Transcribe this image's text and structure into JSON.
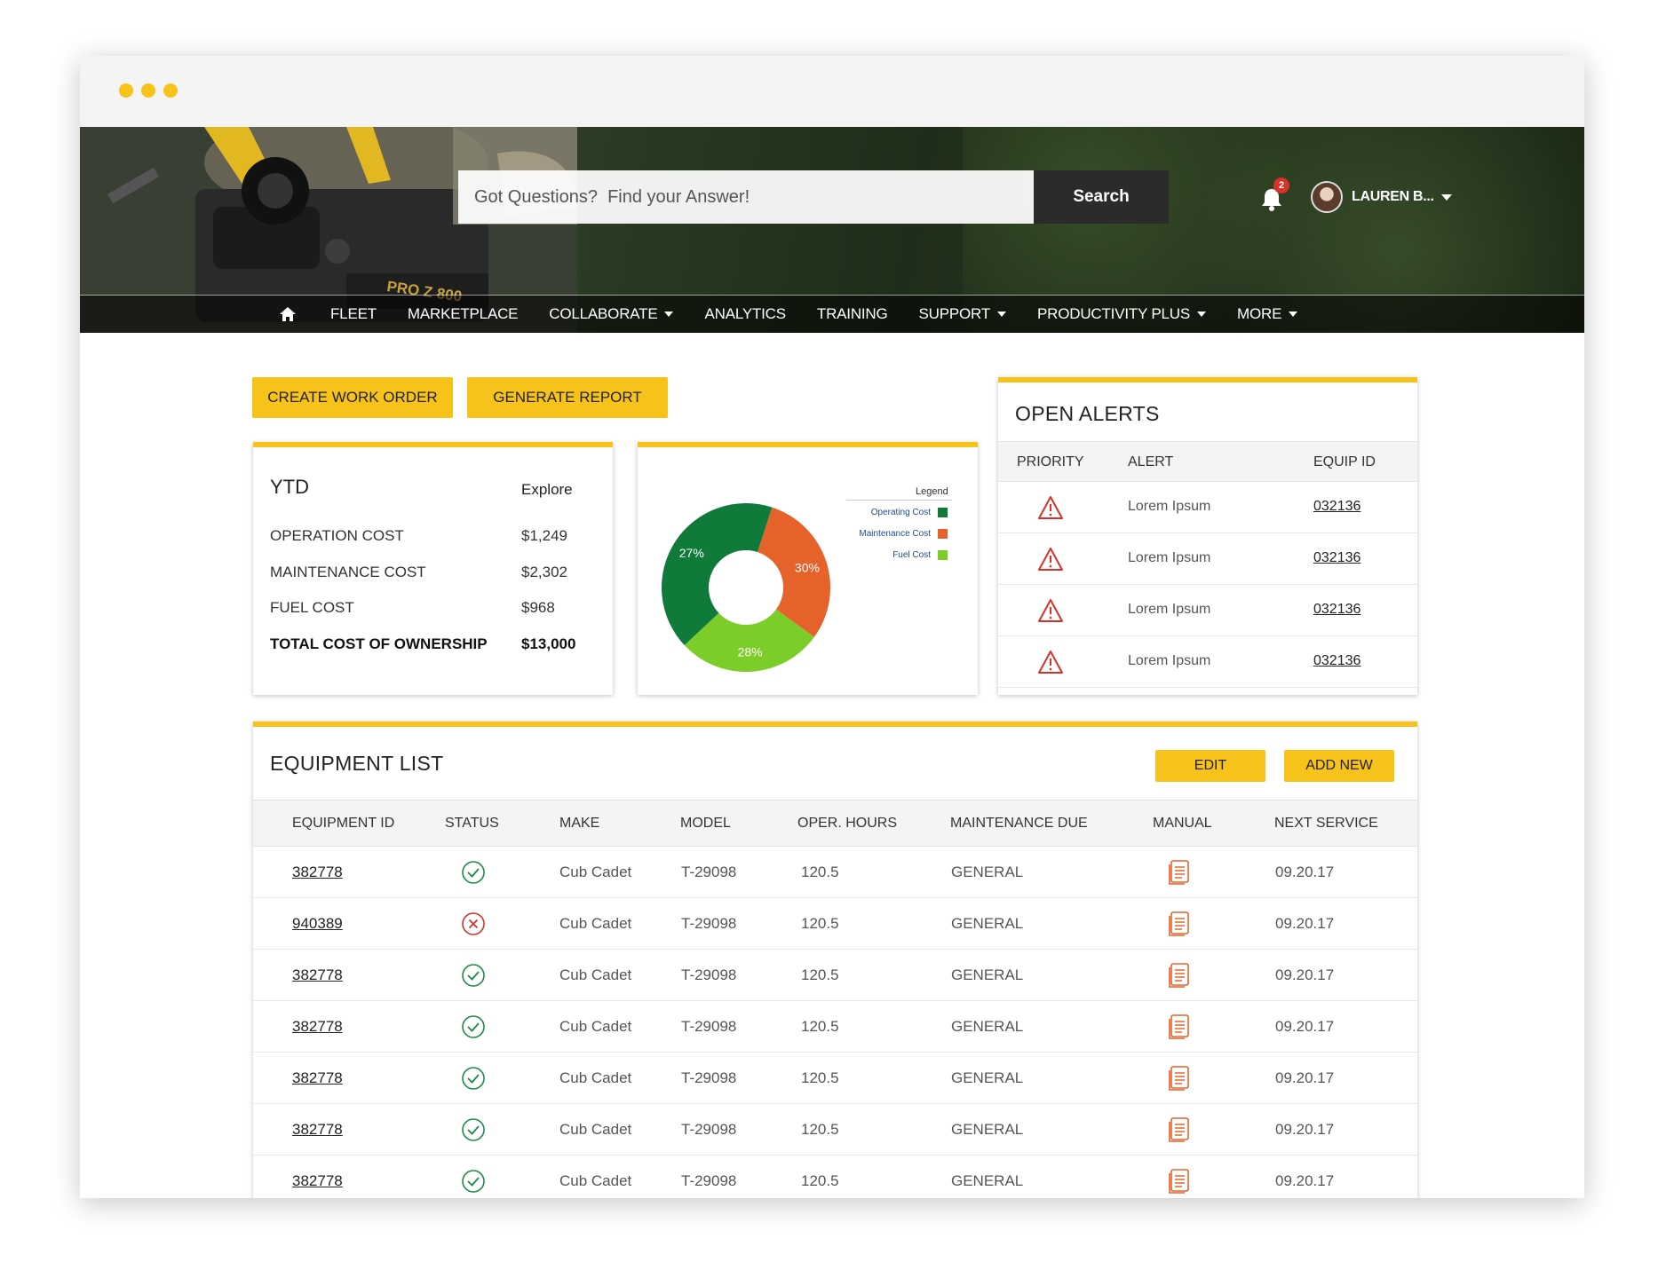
{
  "window": {
    "dots": [
      "#f7c31a",
      "#f7c31a",
      "#f7c31a"
    ]
  },
  "header": {
    "search_placeholder": "Got Questions?  Find your Answer!",
    "search_button": "Search",
    "notification_count": "2",
    "user_name": "LAUREN B...",
    "hero_decal": "PRO Z 800"
  },
  "nav": {
    "items": [
      {
        "label": "FLEET",
        "dropdown": false
      },
      {
        "label": "MARKETPLACE",
        "dropdown": false
      },
      {
        "label": "COLLABORATE",
        "dropdown": true
      },
      {
        "label": "ANALYTICS",
        "dropdown": false
      },
      {
        "label": "TRAINING",
        "dropdown": false
      },
      {
        "label": "SUPPORT",
        "dropdown": true
      },
      {
        "label": "PRODUCTIVITY PLUS",
        "dropdown": true
      },
      {
        "label": "MORE",
        "dropdown": true
      }
    ]
  },
  "actions": {
    "create_work_order": "CREATE WORK ORDER",
    "generate_report": "GENERATE REPORT"
  },
  "ytd": {
    "title": "YTD",
    "explore": "Explore",
    "rows": [
      {
        "label": "OPERATION COST",
        "value": "$1,249"
      },
      {
        "label": "MAINTENANCE COST",
        "value": "$2,302"
      },
      {
        "label": "FUEL COST",
        "value": "$968"
      },
      {
        "label": "TOTAL COST OF OWNERSHIP",
        "value": "$13,000"
      }
    ]
  },
  "chart_data": {
    "type": "pie",
    "legend_title": "Legend",
    "legend_position": "top-right",
    "donut": true,
    "slices": [
      {
        "name": "Operating Cost",
        "value": 42,
        "label": "27%",
        "color": "#0f7a3a"
      },
      {
        "name": "Maintenance  Cost",
        "value": 30,
        "label": "30%",
        "color": "#e5622a"
      },
      {
        "name": "Fuel Cost",
        "value": 28,
        "label": "28%",
        "color": "#7ccc2a"
      }
    ]
  },
  "alerts": {
    "title": "OPEN ALERTS",
    "headers": {
      "priority": "PRIORITY",
      "alert": "ALERT",
      "equip_id": "EQUIP ID"
    },
    "rows": [
      {
        "alert": "Lorem Ipsum",
        "equip_id": "032136"
      },
      {
        "alert": "Lorem Ipsum",
        "equip_id": "032136"
      },
      {
        "alert": "Lorem Ipsum",
        "equip_id": "032136"
      },
      {
        "alert": "Lorem Ipsum",
        "equip_id": "032136"
      }
    ]
  },
  "equipment": {
    "title": "EQUIPMENT LIST",
    "edit_button": "EDIT",
    "add_button": "ADD NEW",
    "headers": {
      "equipment_id": "EQUIPMENT  ID",
      "status": "STATUS",
      "make": "MAKE",
      "model": "MODEL",
      "oper_hours": "OPER. HOURS",
      "maintenance_due": "MAINTENANCE DUE",
      "manual": "MANUAL",
      "next_service": "NEXT SERVICE"
    },
    "rows": [
      {
        "id": "382778",
        "status": "ok",
        "make": "Cub Cadet",
        "model": "T-29098",
        "hours": "120.5",
        "maintenance": "GENERAL",
        "next": "09.20.17"
      },
      {
        "id": "940389",
        "status": "error",
        "make": "Cub Cadet",
        "model": "T-29098",
        "hours": "120.5",
        "maintenance": "GENERAL",
        "next": "09.20.17"
      },
      {
        "id": "382778",
        "status": "ok",
        "make": "Cub Cadet",
        "model": "T-29098",
        "hours": "120.5",
        "maintenance": "GENERAL",
        "next": "09.20.17"
      },
      {
        "id": "382778",
        "status": "ok",
        "make": "Cub Cadet",
        "model": "T-29098",
        "hours": "120.5",
        "maintenance": "GENERAL",
        "next": "09.20.17"
      },
      {
        "id": "382778",
        "status": "ok",
        "make": "Cub Cadet",
        "model": "T-29098",
        "hours": "120.5",
        "maintenance": "GENERAL",
        "next": "09.20.17"
      },
      {
        "id": "382778",
        "status": "ok",
        "make": "Cub Cadet",
        "model": "T-29098",
        "hours": "120.5",
        "maintenance": "GENERAL",
        "next": "09.20.17"
      },
      {
        "id": "382778",
        "status": "ok",
        "make": "Cub Cadet",
        "model": "T-29098",
        "hours": "120.5",
        "maintenance": "GENERAL",
        "next": "09.20.17"
      }
    ]
  },
  "colors": {
    "accent": "#f7c31a",
    "ok": "#1e8a4a",
    "error": "#d6322a",
    "manual_icon": "#e5622a",
    "alert_icon": "#d6322a"
  }
}
